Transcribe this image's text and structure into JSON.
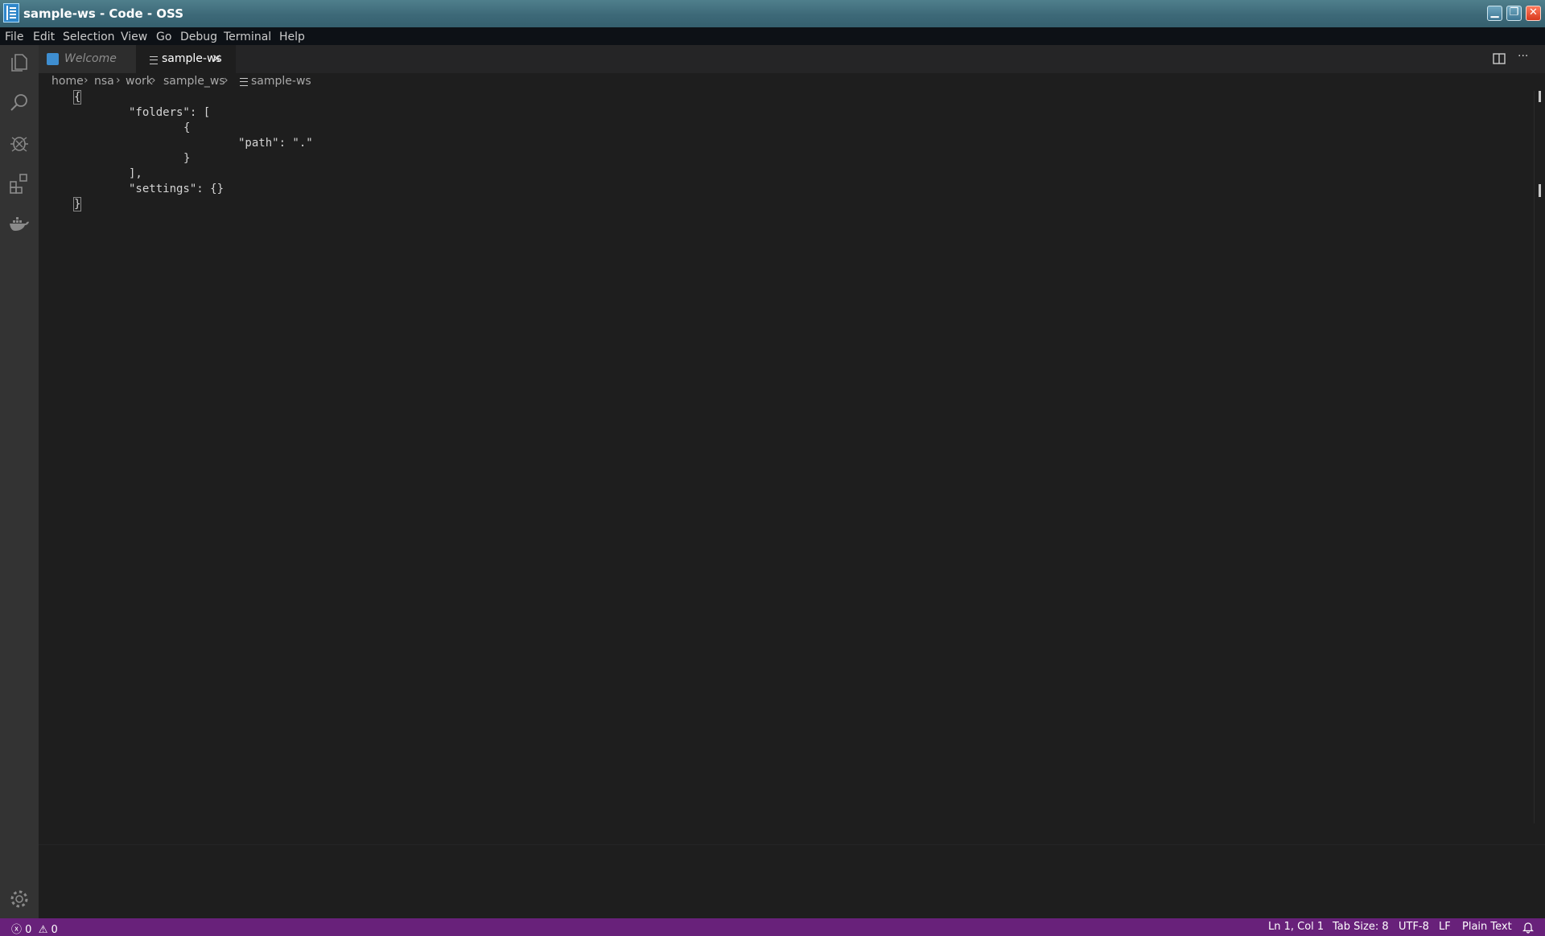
{
  "window": {
    "title": "sample-ws - Code - OSS",
    "buttons": {
      "minimize": "▁",
      "restore": "❐",
      "close": "✕"
    }
  },
  "menu": [
    "File",
    "Edit",
    "Selection",
    "View",
    "Go",
    "Debug",
    "Terminal",
    "Help"
  ],
  "activity_bar": {
    "items": [
      "files-icon",
      "search-icon",
      "debug-icon",
      "extensions-icon",
      "docker-icon"
    ],
    "bottom": "gear-icon"
  },
  "tabs": [
    {
      "label": "Welcome",
      "icon": "vscode-icon",
      "active": false
    },
    {
      "label": "sample-ws",
      "icon": "file-lines-icon",
      "active": true,
      "close": "✕"
    }
  ],
  "editor_actions": {
    "split": "split-editor-icon",
    "more": "···"
  },
  "breadcrumb": [
    "home",
    "nsa",
    "work",
    "sample_ws",
    "sample-ws"
  ],
  "code": [
    "{",
    "\t\"folders\": [",
    "\t\t{",
    "\t\t\t\"path\": \".\"",
    "\t\t}",
    "\t],",
    "\t\"settings\": {}",
    "}"
  ],
  "status": {
    "errors": "0",
    "warnings": "0",
    "position": "Ln 1, Col 1",
    "tab_size": "Tab Size: 8",
    "encoding": "UTF-8",
    "eol": "LF",
    "language": "Plain Text"
  },
  "colors": {
    "status_bar": "#68217a",
    "activity_bar": "#333333",
    "editor_bg": "#1e1e1e"
  }
}
